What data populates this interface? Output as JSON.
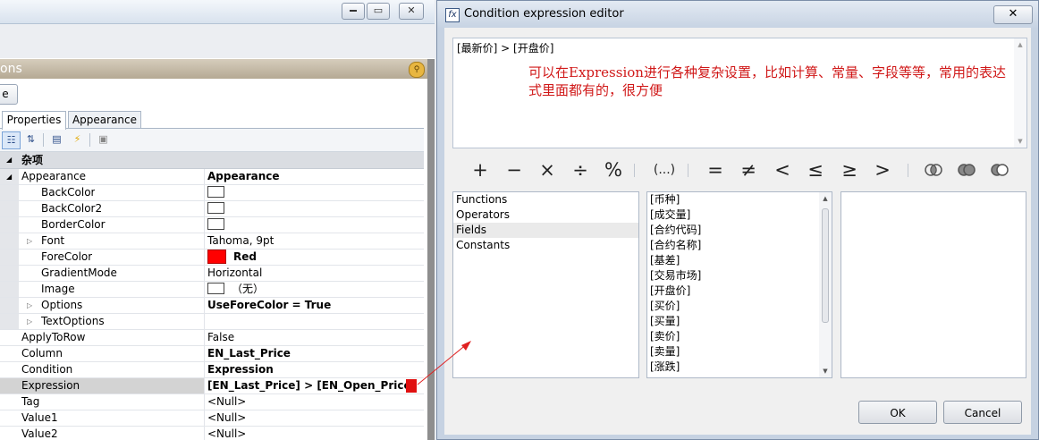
{
  "left_panel": {
    "titlebar_buttons": [
      "▭",
      "✕"
    ],
    "header_fragment": "ons",
    "small_button_fragment": "e",
    "tabs": [
      "Properties",
      "Appearance"
    ],
    "category": "杂项",
    "rows": [
      {
        "name": "Appearance",
        "value": "Appearance",
        "bold": true
      },
      {
        "name": "BackColor",
        "value": ""
      },
      {
        "name": "BackColor2",
        "value": ""
      },
      {
        "name": "BorderColor",
        "value": ""
      },
      {
        "name": "Font",
        "value": "Tahoma, 9pt"
      },
      {
        "name": "ForeColor",
        "value": "Red",
        "bold": true
      },
      {
        "name": "GradientMode",
        "value": "Horizontal"
      },
      {
        "name": "Image",
        "value": "（无）"
      },
      {
        "name": "Options",
        "value": "UseForeColor = True",
        "bold": true
      },
      {
        "name": "TextOptions",
        "value": ""
      },
      {
        "name": "ApplyToRow",
        "value": "False"
      },
      {
        "name": "Column",
        "value": "EN_Last_Price",
        "bold": true
      },
      {
        "name": "Condition",
        "value": "Expression",
        "bold": true
      },
      {
        "name": "Expression",
        "value": "[EN_Last_Price] > [EN_Open_Price]",
        "bold": true
      },
      {
        "name": "Tag",
        "value": "<Null>"
      },
      {
        "name": "Value1",
        "value": "<Null>"
      },
      {
        "name": "Value2",
        "value": "<Null>"
      }
    ],
    "colors": {
      "forecolor": "#ff0000",
      "swatch_border": "#444444",
      "highlight_row": "#d3d3d3"
    }
  },
  "dialog": {
    "title": "Condition expression editor",
    "title_icon": "fx-icon",
    "close_label": "✕",
    "expression": "[最新价] > [开盘价]",
    "note": "可以在Expression进行各种复杂设置，比如计算、常量、字段等等，常用的表达式里面都有的，很方便",
    "operators": [
      "+",
      "−",
      "×",
      "÷",
      "%",
      "(...)",
      "=",
      "≠",
      "<",
      "≤",
      "≥",
      ">"
    ],
    "logic_icons": [
      "and-icon",
      "or-icon",
      "not-icon"
    ],
    "categories": [
      "Functions",
      "Operators",
      "Fields",
      "Constants"
    ],
    "selected_category": "Fields",
    "fields": [
      "[币种]",
      "[成交量]",
      "[合约代码]",
      "[合约名称]",
      "[基差]",
      "[交易市场]",
      "[开盘价]",
      "[买价]",
      "[买量]",
      "[卖价]",
      "[卖量]",
      "[涨跌]"
    ],
    "ok_label": "OK",
    "cancel_label": "Cancel",
    "colors": {
      "note": "#d01818",
      "arrow": "#e02020"
    }
  }
}
